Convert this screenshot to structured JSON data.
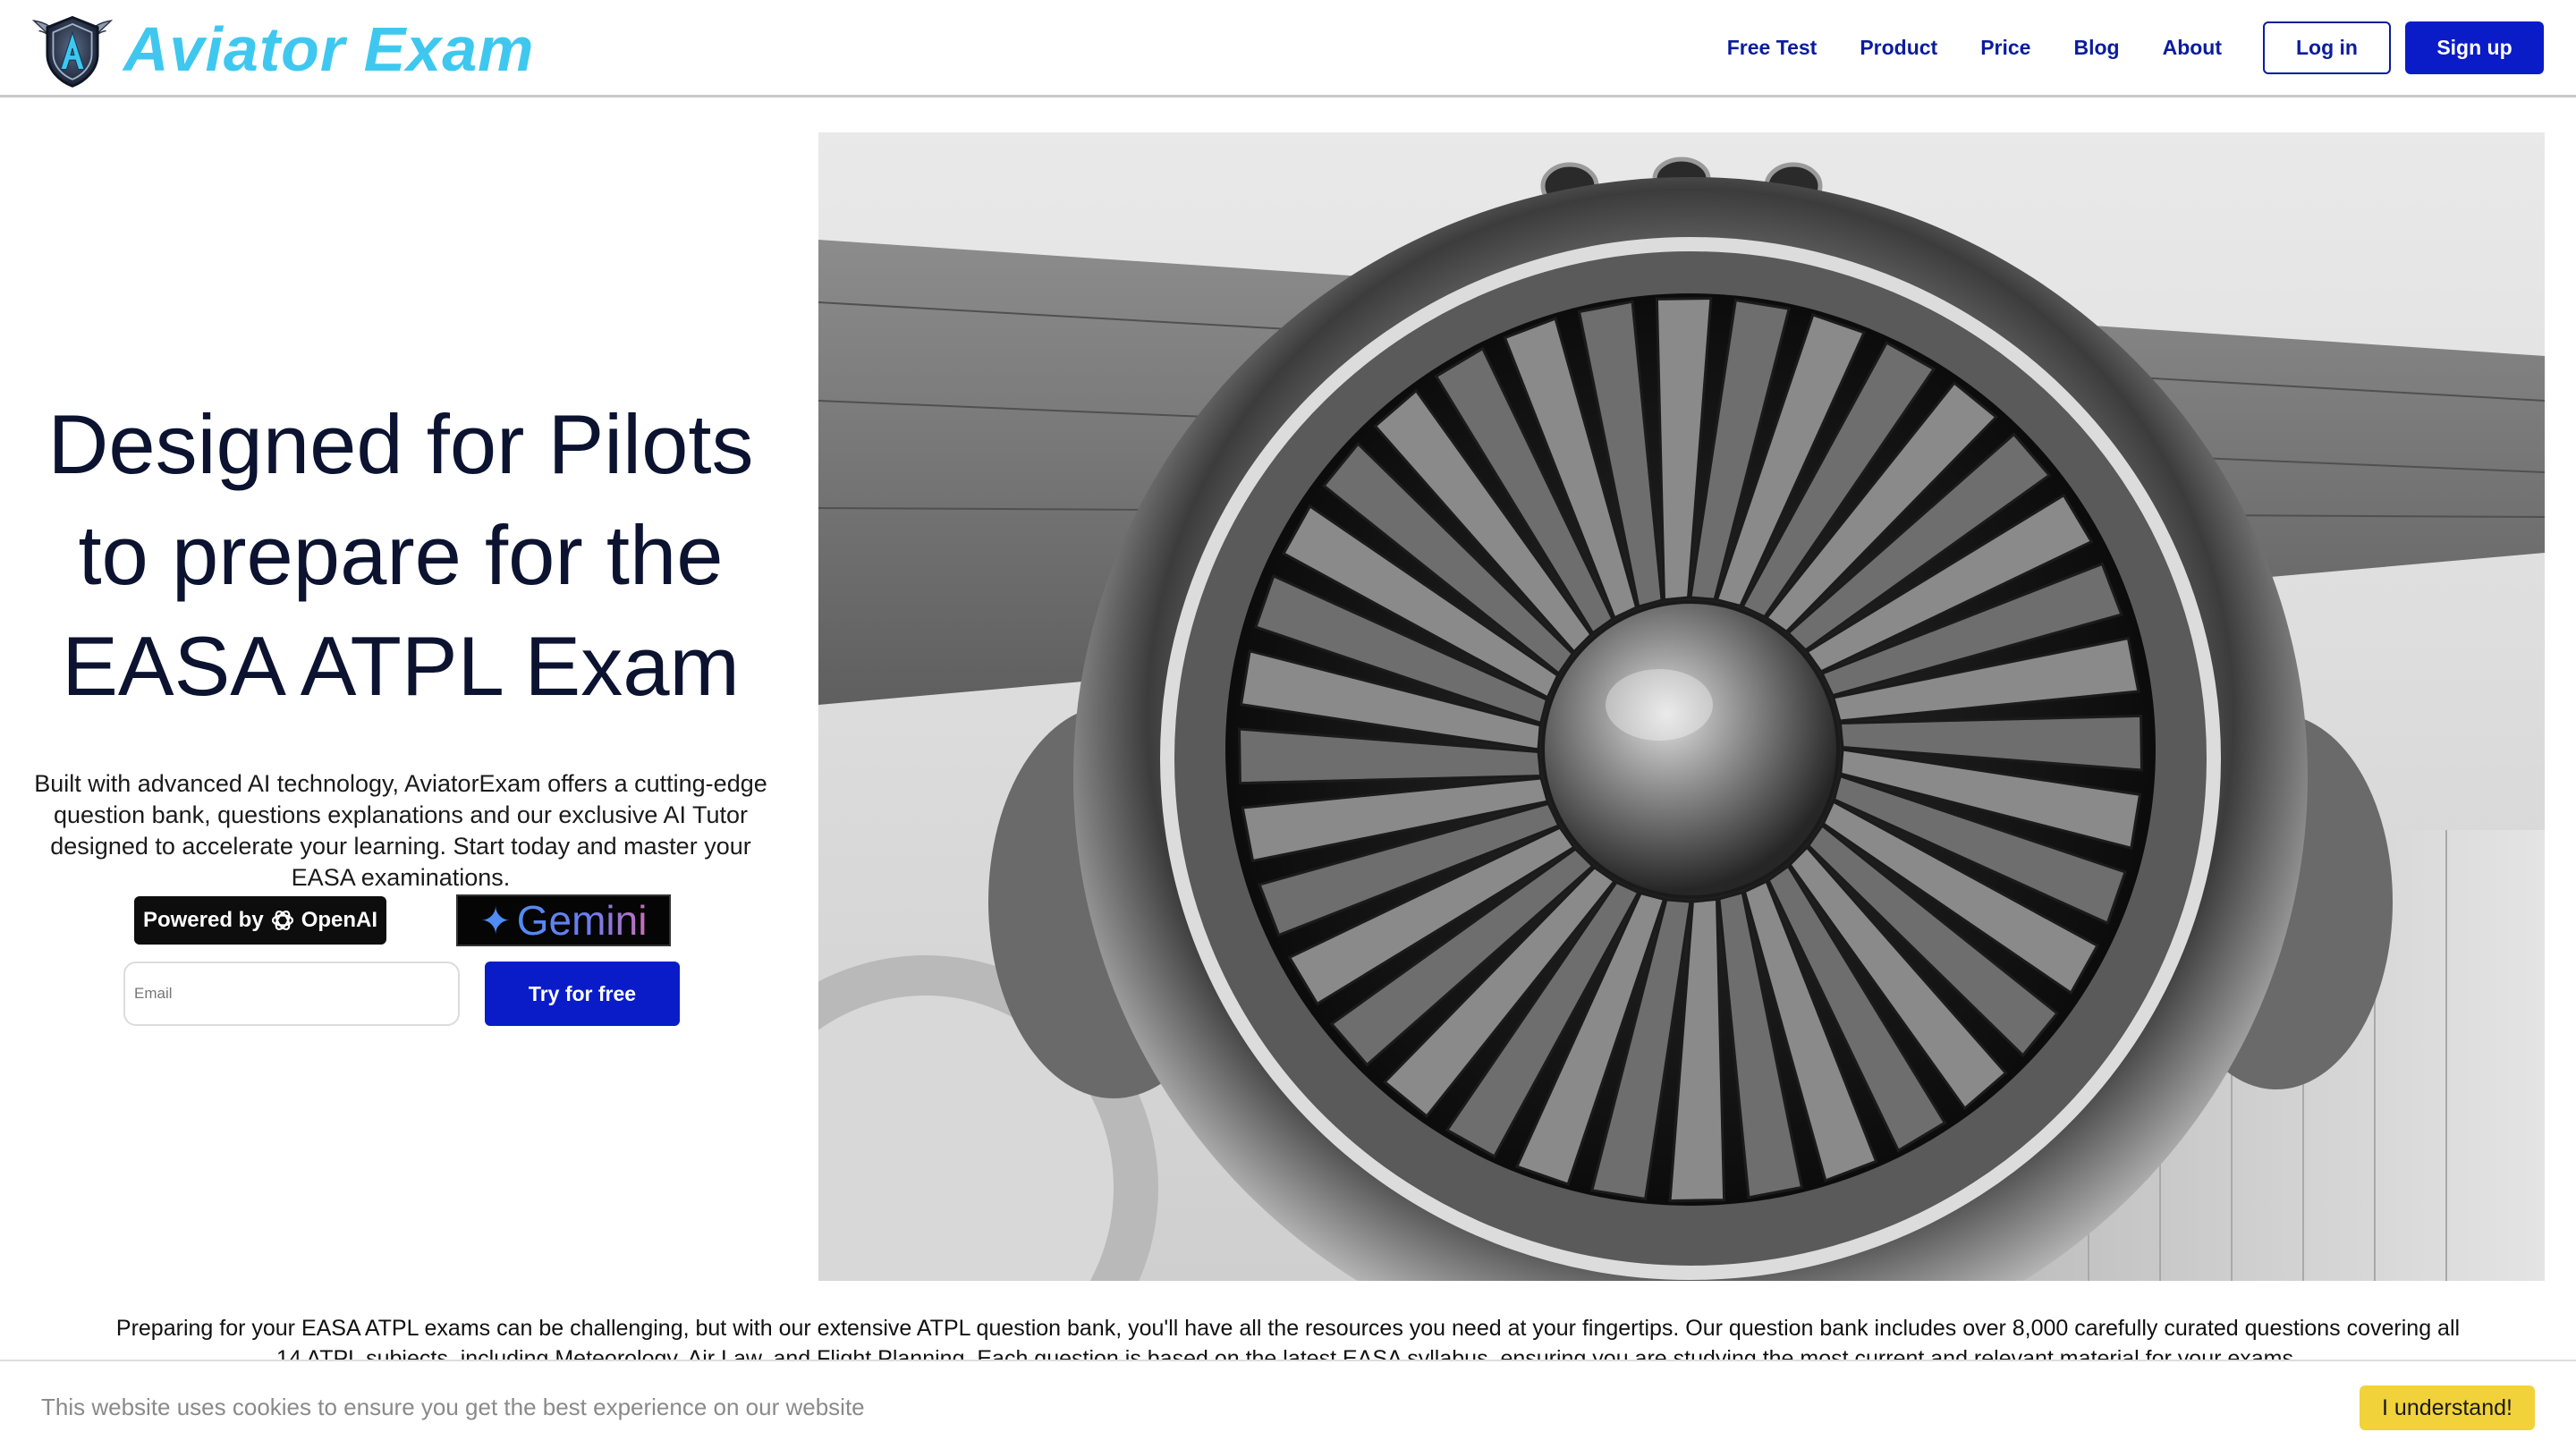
{
  "header": {
    "brand": "Aviator Exam",
    "nav": [
      {
        "label": "Free Test"
      },
      {
        "label": "Product"
      },
      {
        "label": "Price"
      },
      {
        "label": "Blog"
      },
      {
        "label": "About"
      }
    ],
    "login_label": "Log in",
    "signup_label": "Sign up"
  },
  "hero": {
    "title_line1": "Designed for Pilots",
    "title_line2": "to prepare for the",
    "title_line3": "EASA ATPL Exam",
    "subtitle": "Built with advanced AI technology, AviatorExam offers a cutting-edge question bank, questions explanations and our exclusive AI Tutor designed to accelerate your learning. Start today and master your EASA examinations.",
    "badge_openai_prefix": "Powered by",
    "badge_openai_name": "OpenAI",
    "badge_gemini": "Gemini",
    "email_placeholder": "Email",
    "cta_label": "Try for free"
  },
  "intro": {
    "text": "Preparing for your EASA ATPL exams can be challenging, but with our extensive ATPL question bank, you'll have all the resources you need at your fingertips. Our question bank includes over 8,000 carefully curated questions covering all 14 ATPL subjects, including Meteorology, Air Law, and Flight Planning. Each question is based on the latest EASA syllabus, ensuring you are studying the most current and relevant material for your exams."
  },
  "cookie": {
    "text": "This website uses cookies to ensure you get the best experience on our website",
    "button_label": "I understand!"
  },
  "colors": {
    "brand_cyan": "#3fc8ef",
    "primary_blue": "#0a1cc8",
    "nav_blue": "#0a1c9e",
    "cookie_yellow": "#f1d23a",
    "heading_navy": "#0b1330"
  }
}
